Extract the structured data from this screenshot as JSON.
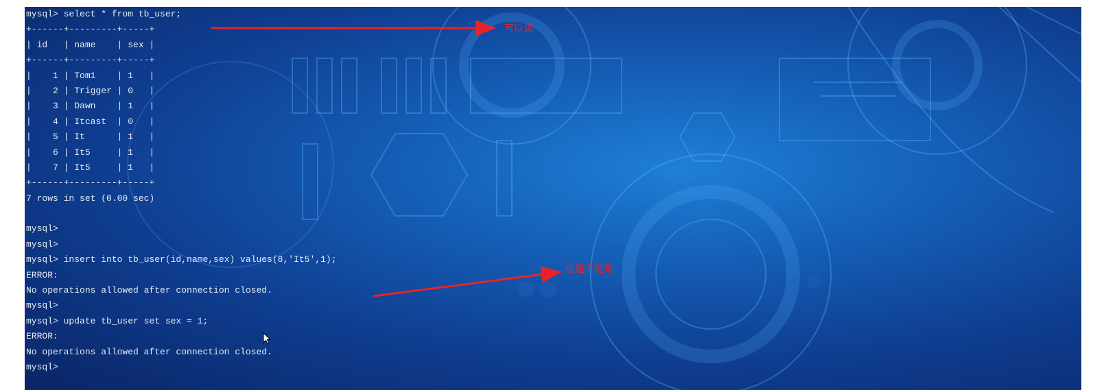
{
  "terminal": {
    "lines": [
      "mysql> select * from tb_user;",
      "+------+---------+-----+",
      "| id   | name    | sex |",
      "+------+---------+-----+",
      "|    1 | Tom1    | 1   |",
      "|    2 | Trigger | 0   |",
      "|    3 | Dawn    | 1   |",
      "|    4 | Itcast  | 0   |",
      "|    5 | It      | 1   |",
      "|    6 | It5     | 1   |",
      "|    7 | It5     | 1   |",
      "+------+---------+-----+",
      "7 rows in set (0.00 sec)",
      "",
      "mysql>",
      "mysql>",
      "mysql> insert into tb_user(id,name,sex) values(8,'It5',1);",
      "ERROR:",
      "No operations allowed after connection closed.",
      "mysql>",
      "mysql> update tb_user set sex = 1;",
      "ERROR:",
      "No operations allowed after connection closed.",
      "mysql>"
    ]
  },
  "annotations": {
    "read_label": "可以读",
    "write_label": "但是不能写",
    "arrow_color": "#e8232a"
  },
  "icons": {
    "cursor": "mouse-pointer-icon"
  }
}
